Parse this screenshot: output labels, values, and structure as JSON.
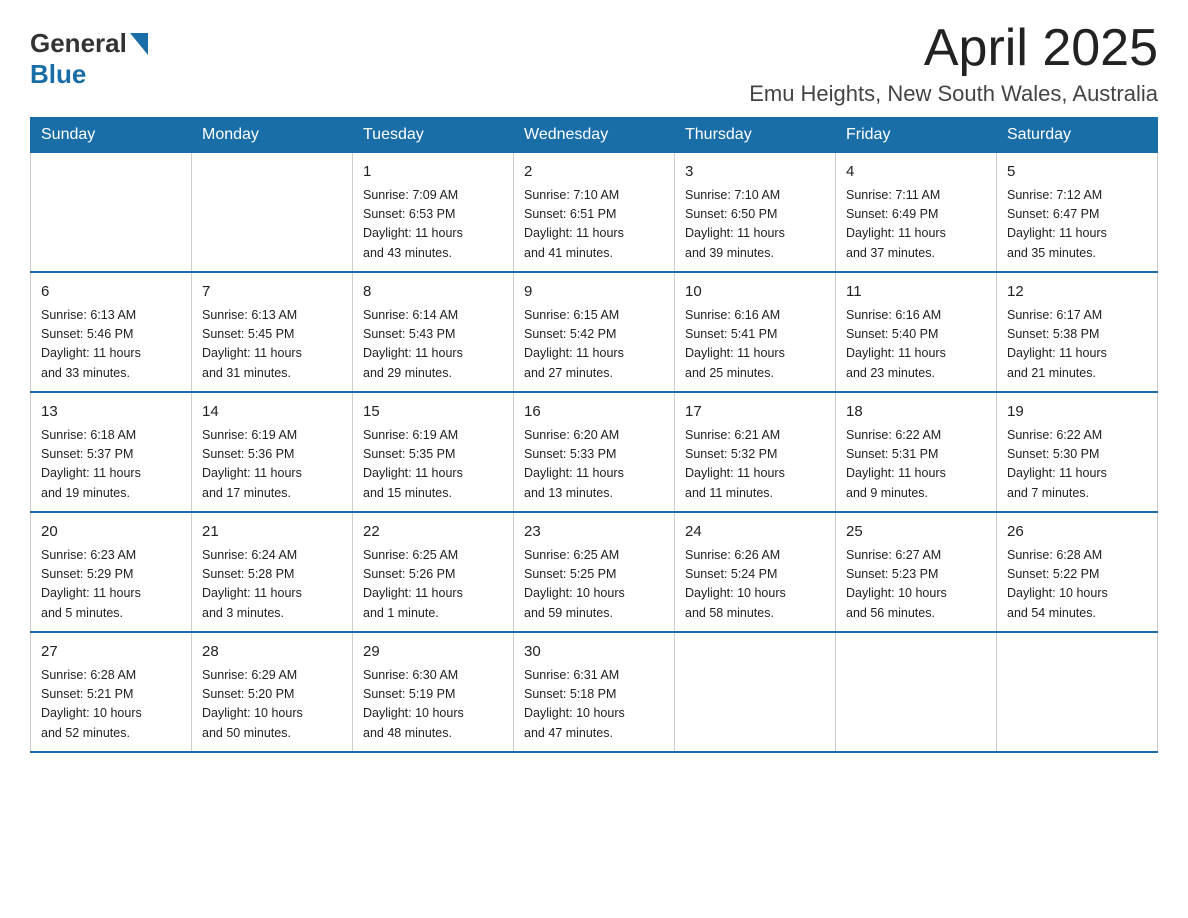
{
  "header": {
    "logo_general": "General",
    "logo_blue": "Blue",
    "month_title": "April 2025",
    "location": "Emu Heights, New South Wales, Australia"
  },
  "calendar": {
    "days_of_week": [
      "Sunday",
      "Monday",
      "Tuesday",
      "Wednesday",
      "Thursday",
      "Friday",
      "Saturday"
    ],
    "weeks": [
      [
        {
          "day": "",
          "info": ""
        },
        {
          "day": "",
          "info": ""
        },
        {
          "day": "1",
          "info": "Sunrise: 7:09 AM\nSunset: 6:53 PM\nDaylight: 11 hours\nand 43 minutes."
        },
        {
          "day": "2",
          "info": "Sunrise: 7:10 AM\nSunset: 6:51 PM\nDaylight: 11 hours\nand 41 minutes."
        },
        {
          "day": "3",
          "info": "Sunrise: 7:10 AM\nSunset: 6:50 PM\nDaylight: 11 hours\nand 39 minutes."
        },
        {
          "day": "4",
          "info": "Sunrise: 7:11 AM\nSunset: 6:49 PM\nDaylight: 11 hours\nand 37 minutes."
        },
        {
          "day": "5",
          "info": "Sunrise: 7:12 AM\nSunset: 6:47 PM\nDaylight: 11 hours\nand 35 minutes."
        }
      ],
      [
        {
          "day": "6",
          "info": "Sunrise: 6:13 AM\nSunset: 5:46 PM\nDaylight: 11 hours\nand 33 minutes."
        },
        {
          "day": "7",
          "info": "Sunrise: 6:13 AM\nSunset: 5:45 PM\nDaylight: 11 hours\nand 31 minutes."
        },
        {
          "day": "8",
          "info": "Sunrise: 6:14 AM\nSunset: 5:43 PM\nDaylight: 11 hours\nand 29 minutes."
        },
        {
          "day": "9",
          "info": "Sunrise: 6:15 AM\nSunset: 5:42 PM\nDaylight: 11 hours\nand 27 minutes."
        },
        {
          "day": "10",
          "info": "Sunrise: 6:16 AM\nSunset: 5:41 PM\nDaylight: 11 hours\nand 25 minutes."
        },
        {
          "day": "11",
          "info": "Sunrise: 6:16 AM\nSunset: 5:40 PM\nDaylight: 11 hours\nand 23 minutes."
        },
        {
          "day": "12",
          "info": "Sunrise: 6:17 AM\nSunset: 5:38 PM\nDaylight: 11 hours\nand 21 minutes."
        }
      ],
      [
        {
          "day": "13",
          "info": "Sunrise: 6:18 AM\nSunset: 5:37 PM\nDaylight: 11 hours\nand 19 minutes."
        },
        {
          "day": "14",
          "info": "Sunrise: 6:19 AM\nSunset: 5:36 PM\nDaylight: 11 hours\nand 17 minutes."
        },
        {
          "day": "15",
          "info": "Sunrise: 6:19 AM\nSunset: 5:35 PM\nDaylight: 11 hours\nand 15 minutes."
        },
        {
          "day": "16",
          "info": "Sunrise: 6:20 AM\nSunset: 5:33 PM\nDaylight: 11 hours\nand 13 minutes."
        },
        {
          "day": "17",
          "info": "Sunrise: 6:21 AM\nSunset: 5:32 PM\nDaylight: 11 hours\nand 11 minutes."
        },
        {
          "day": "18",
          "info": "Sunrise: 6:22 AM\nSunset: 5:31 PM\nDaylight: 11 hours\nand 9 minutes."
        },
        {
          "day": "19",
          "info": "Sunrise: 6:22 AM\nSunset: 5:30 PM\nDaylight: 11 hours\nand 7 minutes."
        }
      ],
      [
        {
          "day": "20",
          "info": "Sunrise: 6:23 AM\nSunset: 5:29 PM\nDaylight: 11 hours\nand 5 minutes."
        },
        {
          "day": "21",
          "info": "Sunrise: 6:24 AM\nSunset: 5:28 PM\nDaylight: 11 hours\nand 3 minutes."
        },
        {
          "day": "22",
          "info": "Sunrise: 6:25 AM\nSunset: 5:26 PM\nDaylight: 11 hours\nand 1 minute."
        },
        {
          "day": "23",
          "info": "Sunrise: 6:25 AM\nSunset: 5:25 PM\nDaylight: 10 hours\nand 59 minutes."
        },
        {
          "day": "24",
          "info": "Sunrise: 6:26 AM\nSunset: 5:24 PM\nDaylight: 10 hours\nand 58 minutes."
        },
        {
          "day": "25",
          "info": "Sunrise: 6:27 AM\nSunset: 5:23 PM\nDaylight: 10 hours\nand 56 minutes."
        },
        {
          "day": "26",
          "info": "Sunrise: 6:28 AM\nSunset: 5:22 PM\nDaylight: 10 hours\nand 54 minutes."
        }
      ],
      [
        {
          "day": "27",
          "info": "Sunrise: 6:28 AM\nSunset: 5:21 PM\nDaylight: 10 hours\nand 52 minutes."
        },
        {
          "day": "28",
          "info": "Sunrise: 6:29 AM\nSunset: 5:20 PM\nDaylight: 10 hours\nand 50 minutes."
        },
        {
          "day": "29",
          "info": "Sunrise: 6:30 AM\nSunset: 5:19 PM\nDaylight: 10 hours\nand 48 minutes."
        },
        {
          "day": "30",
          "info": "Sunrise: 6:31 AM\nSunset: 5:18 PM\nDaylight: 10 hours\nand 47 minutes."
        },
        {
          "day": "",
          "info": ""
        },
        {
          "day": "",
          "info": ""
        },
        {
          "day": "",
          "info": ""
        }
      ]
    ]
  }
}
